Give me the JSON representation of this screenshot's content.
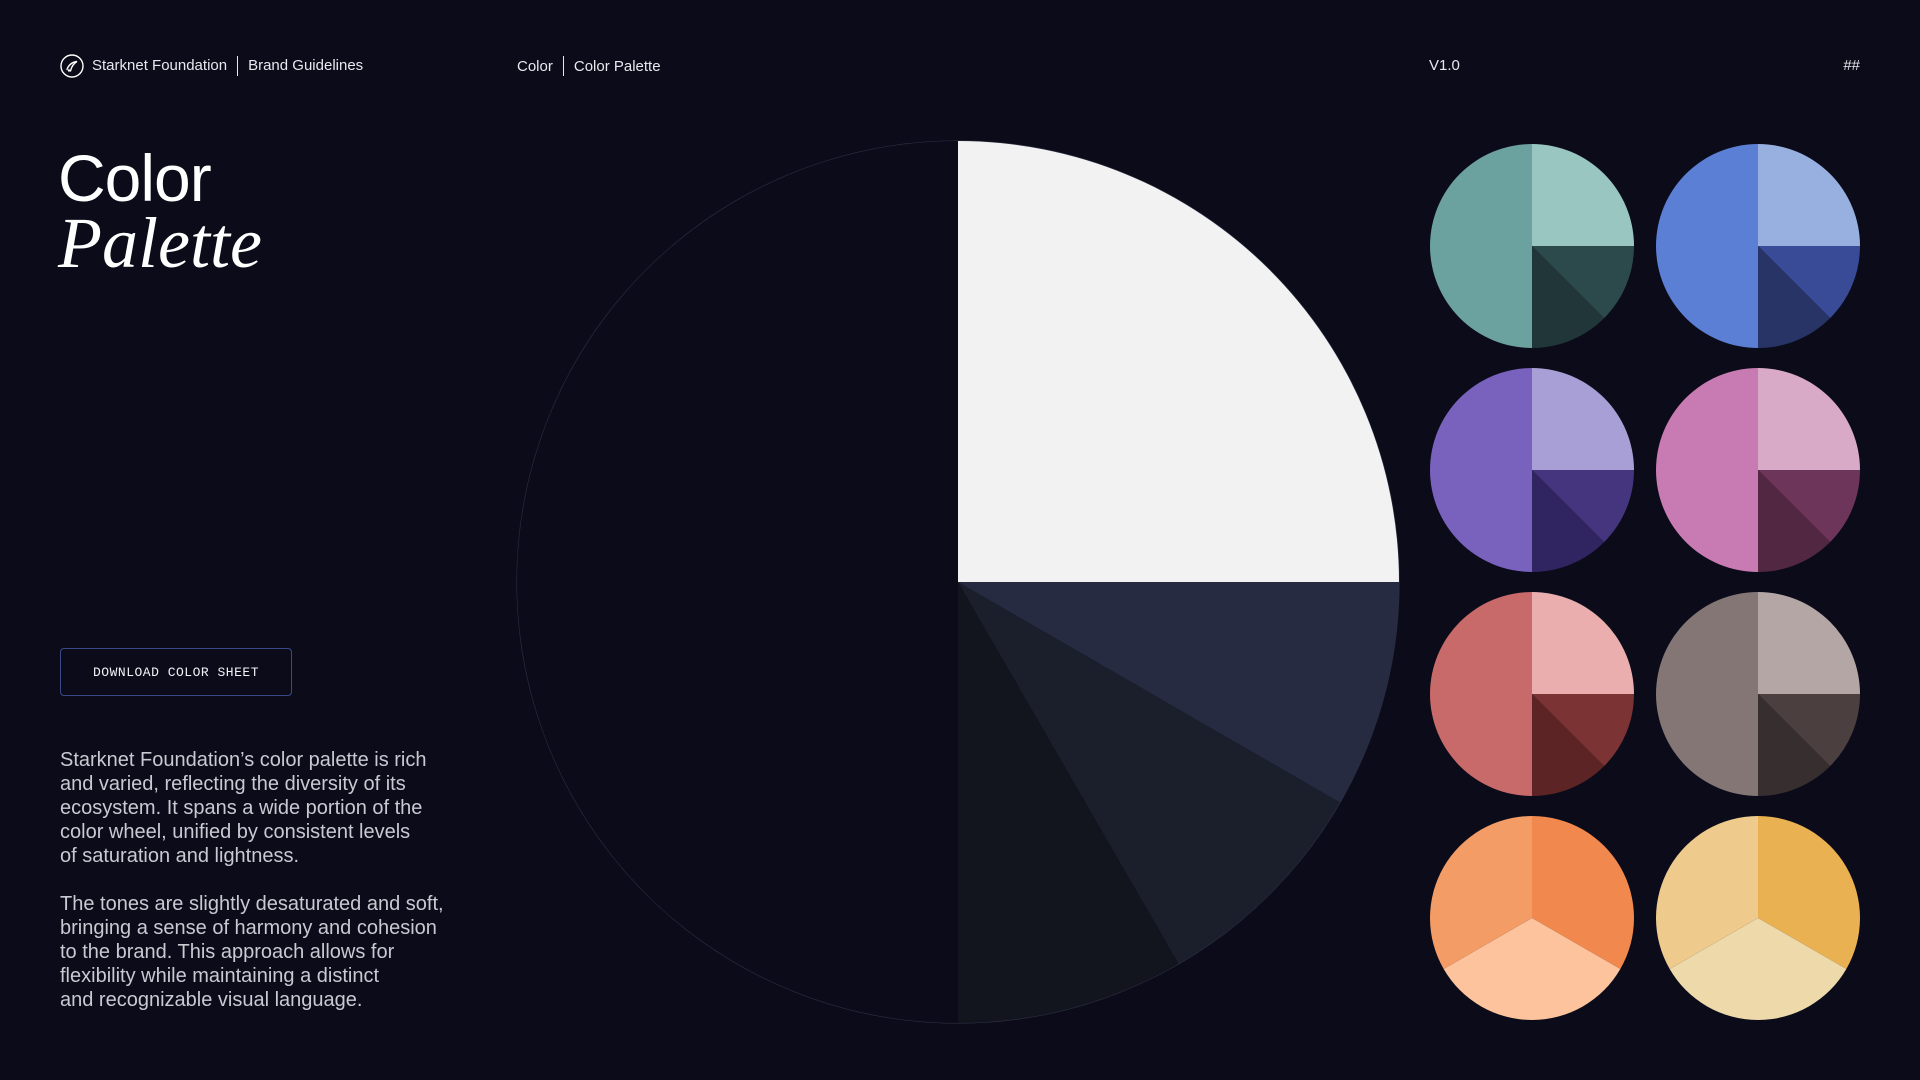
{
  "header": {
    "org": "Starknet Foundation",
    "doc": "Brand Guidelines",
    "section": "Color",
    "page": "Color Palette",
    "version": "V1.0",
    "hash": "##"
  },
  "title": {
    "line1": "Color",
    "line2": "Palette"
  },
  "download_button": "DOWNLOAD COLOR SHEET",
  "description": [
    "Starknet Foundation’s color palette is rich\nand varied, reflecting the diversity of its\necosystem. It spans a wide portion of the\ncolor wheel, unified by consistent levels\nof saturation and lightness.",
    "The tones are slightly desaturated and soft,\nbringing a sense of harmony and cohesion\nto the brand. This approach allows for\nflexibility while maintaining a distinct\nand recognizable visual language."
  ],
  "main_wheel": {
    "colors": {
      "background_half": "#0b0b19",
      "white": "#f2f2f2",
      "navy": "#262b42",
      "dark1": "#1b1f2c",
      "dark2": "#12151d",
      "outline": "#2a2e40"
    }
  },
  "swatches": [
    {
      "name": "teal",
      "main": "#6ba19f",
      "light": "#9ac6c2",
      "dark1": "#2c4a4c",
      "dark2": "#213639"
    },
    {
      "name": "blue",
      "main": "#5b7fd4",
      "light": "#98b0df",
      "dark1": "#394a97",
      "dark2": "#273465"
    },
    {
      "name": "purple",
      "main": "#7962bd",
      "light": "#a89fd6",
      "dark1": "#45357e",
      "dark2": "#302561"
    },
    {
      "name": "pink",
      "main": "#c87bb2",
      "light": "#d8aac7",
      "dark1": "#6c3559",
      "dark2": "#512741"
    },
    {
      "name": "red",
      "main": "#c96a6a",
      "light": "#eaaeae",
      "dark1": "#7b3333",
      "dark2": "#5c2424"
    },
    {
      "name": "taupe",
      "main": "#857676",
      "light": "#b5a6a6",
      "dark1": "#4b3f40",
      "dark2": "#362e2f"
    },
    {
      "name": "orange",
      "main": "#f49c66",
      "light": "#f1884d",
      "bottom": "#fcc39d"
    },
    {
      "name": "yellow",
      "main": "#eecb8d",
      "light": "#eab152",
      "bottom": "#eed9ab"
    }
  ]
}
